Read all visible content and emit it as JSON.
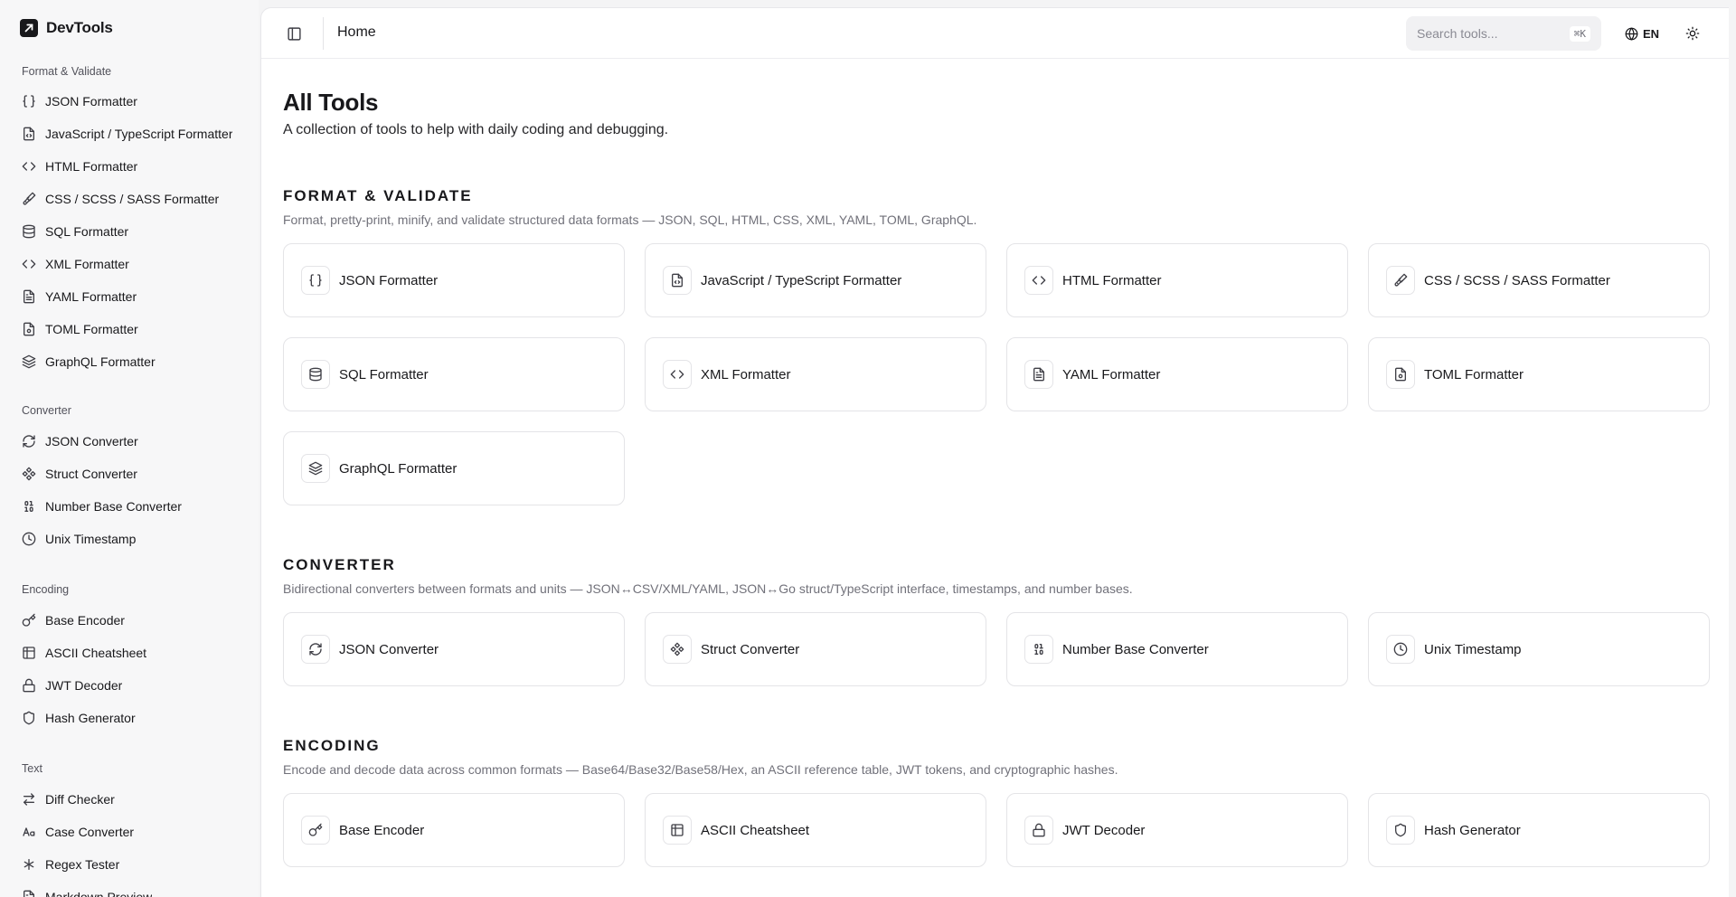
{
  "app": {
    "name": "DevTools"
  },
  "sidebar": {
    "groups": [
      {
        "label": "Format & Validate",
        "items": [
          {
            "label": "JSON Formatter",
            "icon": "braces-icon"
          },
          {
            "label": "JavaScript / TypeScript Formatter",
            "icon": "file-code-icon"
          },
          {
            "label": "HTML Formatter",
            "icon": "code-icon"
          },
          {
            "label": "CSS / SCSS / SASS Formatter",
            "icon": "paintbrush-icon"
          },
          {
            "label": "SQL Formatter",
            "icon": "database-icon"
          },
          {
            "label": "XML Formatter",
            "icon": "code-icon"
          },
          {
            "label": "YAML Formatter",
            "icon": "file-text-icon"
          },
          {
            "label": "TOML Formatter",
            "icon": "file-cog-icon"
          },
          {
            "label": "GraphQL Formatter",
            "icon": "layers-icon"
          }
        ]
      },
      {
        "label": "Converter",
        "items": [
          {
            "label": "JSON Converter",
            "icon": "refresh-icon"
          },
          {
            "label": "Struct Converter",
            "icon": "component-icon"
          },
          {
            "label": "Number Base Converter",
            "icon": "binary-icon"
          },
          {
            "label": "Unix Timestamp",
            "icon": "clock-icon"
          }
        ]
      },
      {
        "label": "Encoding",
        "items": [
          {
            "label": "Base Encoder",
            "icon": "key-icon"
          },
          {
            "label": "ASCII Cheatsheet",
            "icon": "table-icon"
          },
          {
            "label": "JWT Decoder",
            "icon": "lock-icon"
          },
          {
            "label": "Hash Generator",
            "icon": "shield-icon"
          }
        ]
      },
      {
        "label": "Text",
        "items": [
          {
            "label": "Diff Checker",
            "icon": "arrows-diff-icon"
          },
          {
            "label": "Case Converter",
            "icon": "case-icon"
          },
          {
            "label": "Regex Tester",
            "icon": "asterisk-icon"
          },
          {
            "label": "Markdown Preview",
            "icon": "file-text-icon"
          }
        ]
      }
    ]
  },
  "header": {
    "breadcrumb": "Home",
    "search_placeholder": "Search tools...",
    "search_shortcut": "⌘K",
    "language": "EN"
  },
  "main": {
    "title": "All Tools",
    "subtitle": "A collection of tools to help with daily coding and debugging.",
    "sections": [
      {
        "title": "FORMAT & VALIDATE",
        "description": "Format, pretty-print, minify, and validate structured data formats — JSON, SQL, HTML, CSS, XML, YAML, TOML, GraphQL.",
        "tools": [
          {
            "label": "JSON Formatter",
            "icon": "braces-icon"
          },
          {
            "label": "JavaScript / TypeScript Formatter",
            "icon": "file-code-icon"
          },
          {
            "label": "HTML Formatter",
            "icon": "code-icon"
          },
          {
            "label": "CSS / SCSS / SASS Formatter",
            "icon": "paintbrush-icon"
          },
          {
            "label": "SQL Formatter",
            "icon": "database-icon"
          },
          {
            "label": "XML Formatter",
            "icon": "code-icon"
          },
          {
            "label": "YAML Formatter",
            "icon": "file-text-icon"
          },
          {
            "label": "TOML Formatter",
            "icon": "file-cog-icon"
          },
          {
            "label": "GraphQL Formatter",
            "icon": "layers-icon"
          }
        ]
      },
      {
        "title": "CONVERTER",
        "description": "Bidirectional converters between formats and units — JSON↔CSV/XML/YAML, JSON↔Go struct/TypeScript interface, timestamps, and number bases.",
        "tools": [
          {
            "label": "JSON Converter",
            "icon": "refresh-icon"
          },
          {
            "label": "Struct Converter",
            "icon": "component-icon"
          },
          {
            "label": "Number Base Converter",
            "icon": "binary-icon"
          },
          {
            "label": "Unix Timestamp",
            "icon": "clock-icon"
          }
        ]
      },
      {
        "title": "ENCODING",
        "description": "Encode and decode data across common formats — Base64/Base32/Base58/Hex, an ASCII reference table, JWT tokens, and cryptographic hashes.",
        "tools": [
          {
            "label": "Base Encoder",
            "icon": "key-icon"
          },
          {
            "label": "ASCII Cheatsheet",
            "icon": "table-icon"
          },
          {
            "label": "JWT Decoder",
            "icon": "lock-icon"
          },
          {
            "label": "Hash Generator",
            "icon": "shield-icon"
          }
        ]
      }
    ]
  }
}
